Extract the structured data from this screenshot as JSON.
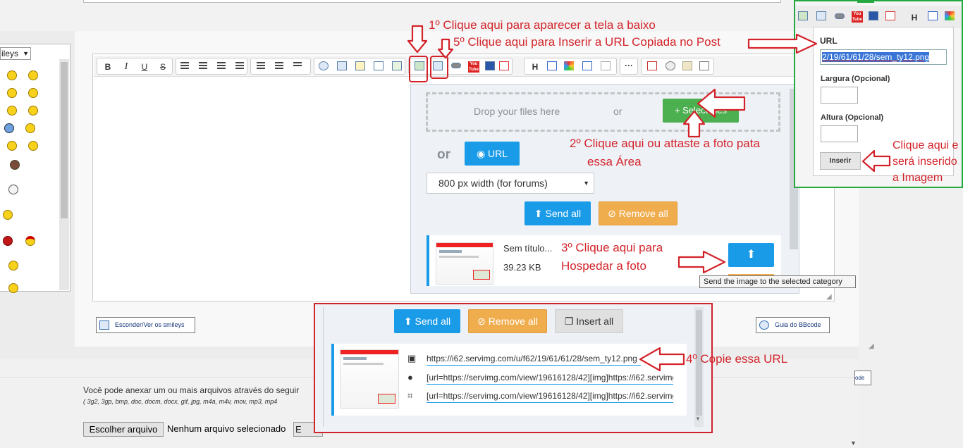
{
  "annotations": {
    "step1": "1º Clique aqui para aparecer a tela a baixo",
    "step5": "5º Clique aqui para Inserir a URL Copiada no Post",
    "step2_line1": "2º Clique aqui ou attaste a foto pata",
    "step2_line2": "essa Área",
    "step3_line1": "3º Clique aqui para",
    "step3_line2": "Hospedar a foto",
    "step4": "4º Copie essa URL",
    "insert_line1": "Clique aqui e",
    "insert_line2": "será inserido",
    "insert_line3": "a Imagem"
  },
  "smileys": {
    "select_label": "ileys",
    "select_arrow": "▼"
  },
  "toolbar": {
    "bold": "B",
    "italic": "I",
    "underline": "U",
    "strike": "S",
    "yt_label": "You Tube",
    "heading": "H"
  },
  "upload": {
    "drop_text": "Drop your files here",
    "or_small": "or",
    "select_files": "+ Select files",
    "or_big": "or",
    "url_button": "◉ URL",
    "width_select": "800 px width (for forums)",
    "width_caret": "▼",
    "send_all": "⬆ Send all",
    "remove_all": "⊘ Remove all",
    "file_name": "Sem título...",
    "file_size": "39.23 KB",
    "upload_icon": "⬆",
    "tooltip": "Send the image to the selected category"
  },
  "result_panel": {
    "send_all": "⬆ Send all",
    "remove_all": "⊘ Remove all",
    "insert_all": "❐ Insert all",
    "url_direct": "https://i62.servimg.com/u/f62/19/61/61/28/sem_ty12.png",
    "url_bbcode": "[url=https://servimg.com/view/19616128/42][img]https://i62.servimg",
    "url_thumb": "[url=https://servimg.com/view/19616128/42][img]https://i62.servimg"
  },
  "buttons": {
    "smileys_toggle": "Esconder/Ver os smileys",
    "bbcode_guide": "Guia do BBcode",
    "odo_partial": "ode"
  },
  "attachments": {
    "intro": "Você pode anexar um ou mais arquivos através do seguir",
    "extensions": "( 3g2, 3gp, bmp, doc, docm, docx, gif, jpg, m4a, m4v, mov, mp3, mp4",
    "choose_file": "Escolher arquivo",
    "no_file": "Nenhum arquivo selecionado",
    "second_btn": "E"
  },
  "url_popup": {
    "url_label": "URL",
    "url_value": "2/19/61/61/28/sem_ty12.png",
    "width_label": "Largura (Opcional)",
    "height_label": "Altura (Opcional)",
    "insert": "Inserir"
  },
  "colors": {
    "annotation_red": "#d3232a",
    "primary_blue": "#1a9be8",
    "success_green": "#4caf50",
    "warning_orange": "#f0ad4e",
    "popup_border_green": "#26a841"
  }
}
